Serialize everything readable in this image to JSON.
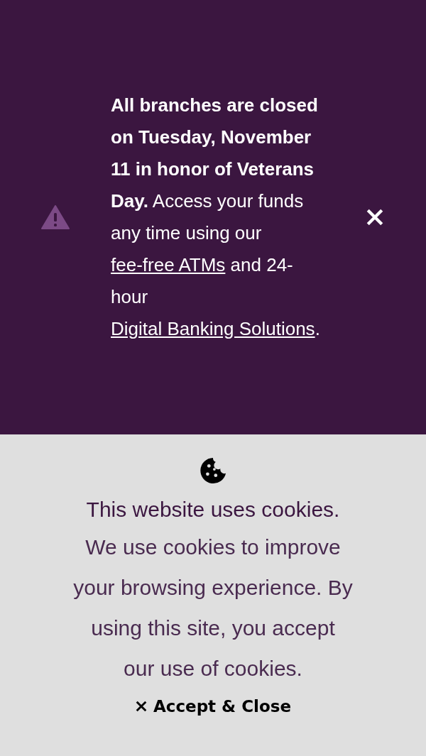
{
  "alert": {
    "message": [
      {
        "kind": "bold",
        "text": "All branches are closed on Tuesday, November 11 in honor of Veterans Day."
      },
      {
        "kind": "text",
        "text": " Access your funds any time using our "
      },
      {
        "kind": "link",
        "text": "fee-free ATMs"
      },
      {
        "kind": "text",
        "text": " and 24-hour "
      },
      {
        "kind": "link",
        "text": "Digital Banking Solutions"
      },
      {
        "kind": "text",
        "text": "."
      }
    ]
  },
  "cookie_notice": {
    "title": "This website uses cookies.",
    "body": "We use cookies to improve your browsing experience. By using this site, you accept our use of cookies.",
    "button": "Accept & Close"
  }
}
